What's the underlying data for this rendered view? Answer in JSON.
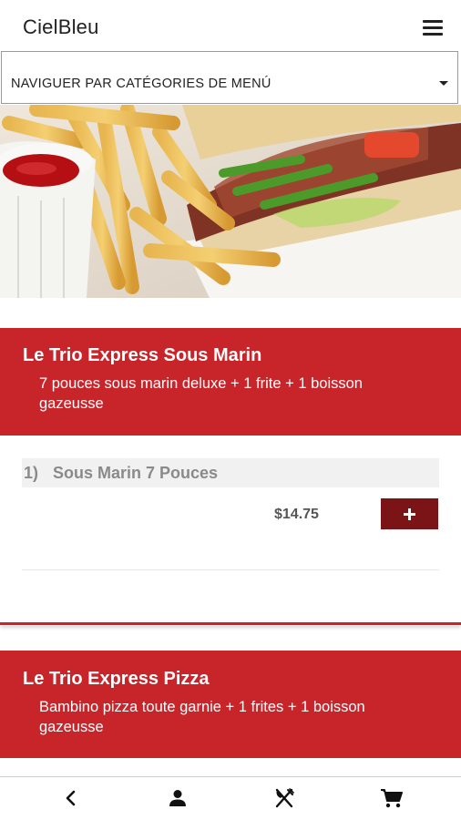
{
  "app": {
    "title": "CielBleu"
  },
  "category_nav": {
    "label": "NAVIGUER PAR CATÉGORIES DE MENÚ"
  },
  "menu_sections": [
    {
      "title": "Le Trio Express Sous Marin",
      "description": "7 pouces sous marin deluxe + 1 frite + 1 boisson gazeusse",
      "items": [
        {
          "number": "1)",
          "name": "Sous Marin 7 Pouces",
          "price": "$14.75"
        }
      ]
    },
    {
      "title": "Le Trio Express Pizza",
      "description": "Bambino pizza toute garnie + 1 frites + 1 boisson gazeusse"
    }
  ],
  "icons": {
    "menu": "hamburger-menu-icon",
    "dropdown": "caret-down-icon",
    "add": "plus-icon",
    "back": "chevron-left-icon",
    "account": "person-icon",
    "restaurant": "fork-knife-icon",
    "cart": "shopping-cart-icon"
  },
  "colors": {
    "brand_red": "#c8252b",
    "button_dark_red": "#7b1417"
  }
}
